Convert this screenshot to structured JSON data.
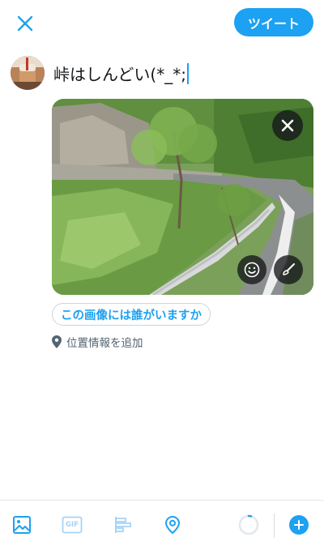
{
  "header": {
    "close_icon": "close-icon",
    "tweet_label": "ツイート"
  },
  "compose": {
    "text": "峠はしんどい(*_*;",
    "avatar_icon": "avatar"
  },
  "media": {
    "remove_icon": "close-icon",
    "sticker_icon": "smiley-icon",
    "edit_icon": "brush-icon"
  },
  "tag_people_label": "この画像には誰がいますか",
  "location": {
    "icon": "location-pin-icon",
    "label": "位置情報を追加"
  },
  "toolbar": {
    "icons": [
      "image-icon",
      "gif-icon",
      "poll-icon",
      "location-icon",
      "character-counter",
      "add-icon"
    ],
    "gif_label": "GIF"
  },
  "colors": {
    "accent": "#1da1f2",
    "text": "#14171a",
    "secondary": "#536471",
    "border": "#e1e8ed"
  }
}
